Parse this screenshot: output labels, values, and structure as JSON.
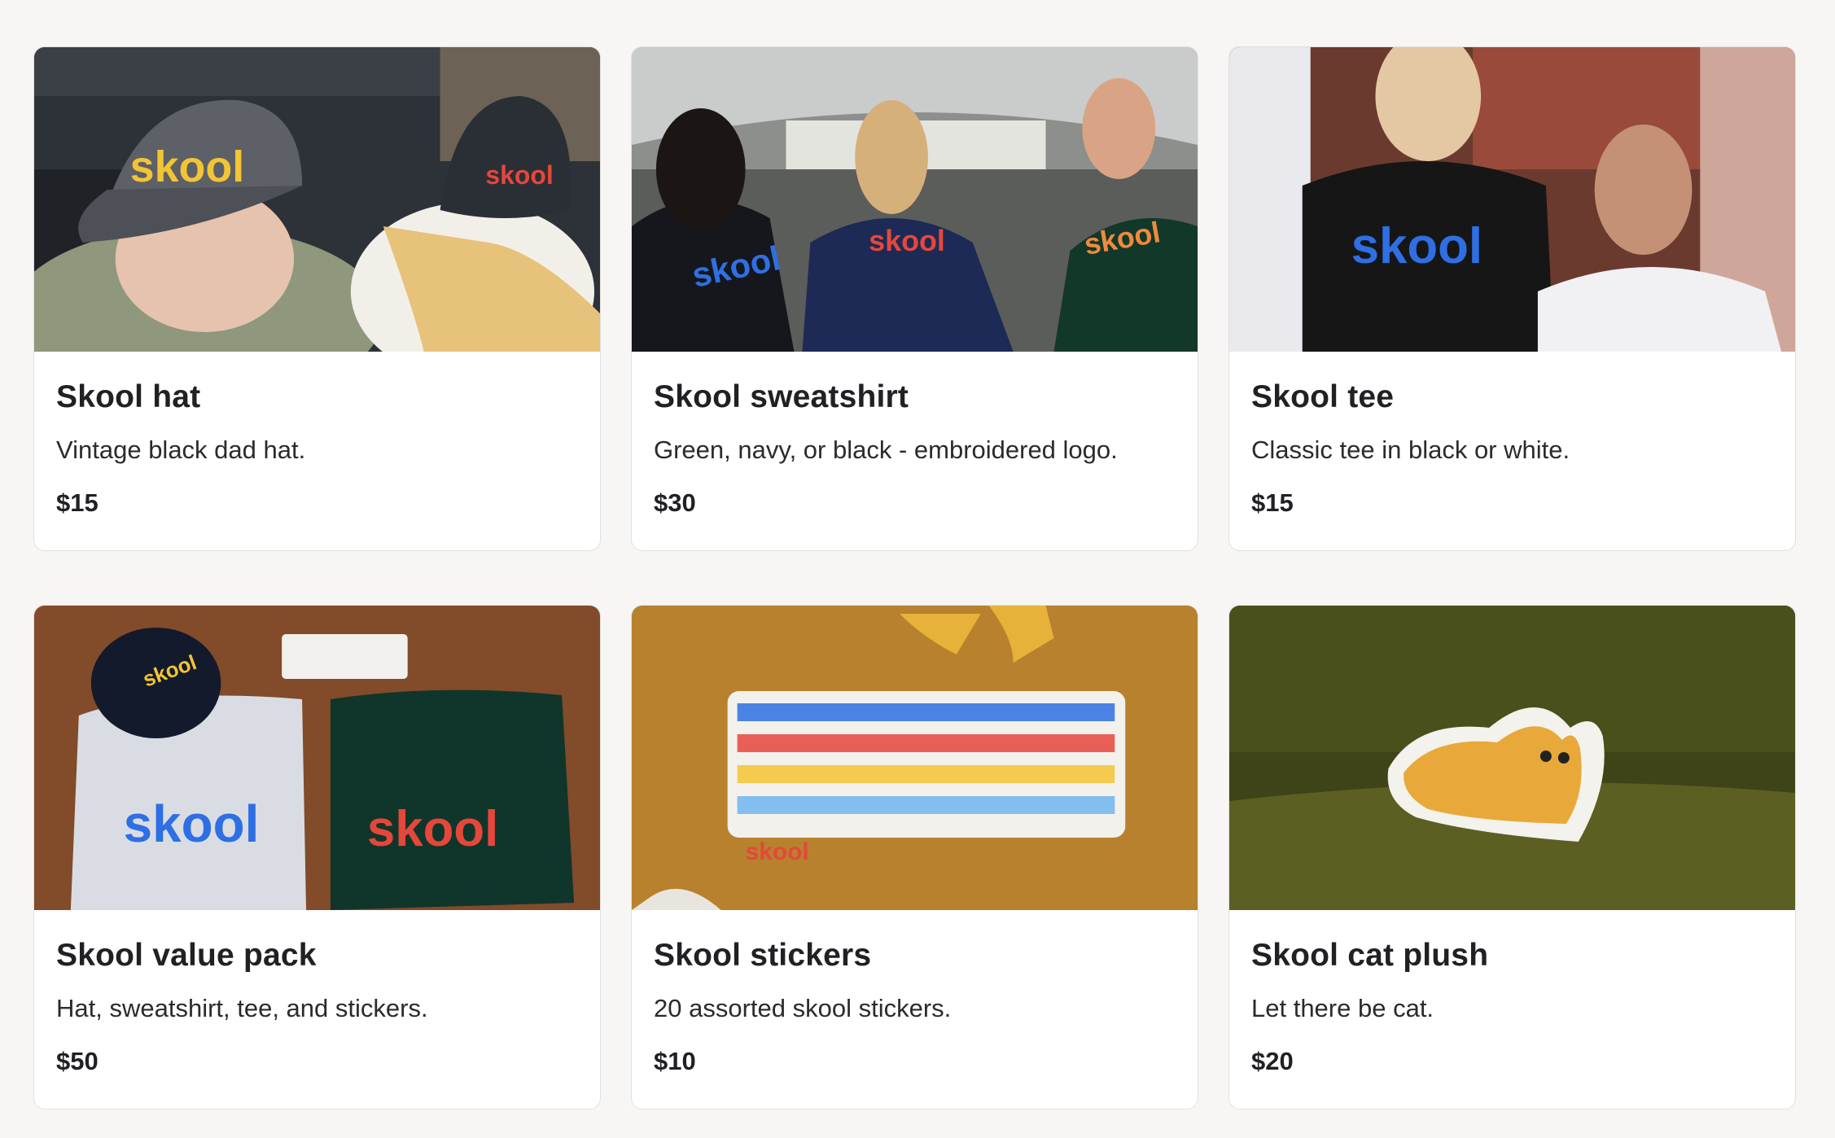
{
  "brand_colors": {
    "blue": "#2f6fe4",
    "red": "#e5473b",
    "yellow": "#f3c433",
    "orange": "#f08a3c",
    "light_blue": "#6fb5ef"
  },
  "products": [
    {
      "title": "Skool hat",
      "description": "Vintage black dad hat.",
      "price": "$15",
      "image_icon": "hat-photo-icon",
      "logo_text": "skool"
    },
    {
      "title": "Skool sweatshirt",
      "description": "Green, navy, or black - embroidered logo.",
      "price": "$30",
      "image_icon": "sweatshirt-photo-icon",
      "logo_text": "skool"
    },
    {
      "title": "Skool tee",
      "description": "Classic tee in black or white.",
      "price": "$15",
      "image_icon": "tee-photo-icon",
      "logo_text": "skool"
    },
    {
      "title": "Skool value pack",
      "description": "Hat, sweatshirt, tee, and stickers.",
      "price": "$50",
      "image_icon": "value-pack-photo-icon",
      "logo_text": "skool"
    },
    {
      "title": "Skool stickers",
      "description": "20 assorted skool stickers.",
      "price": "$10",
      "image_icon": "stickers-photo-icon",
      "logo_text": "skool"
    },
    {
      "title": "Skool cat plush",
      "description": "Let there be cat.",
      "price": "$20",
      "image_icon": "cat-plush-photo-icon"
    }
  ]
}
